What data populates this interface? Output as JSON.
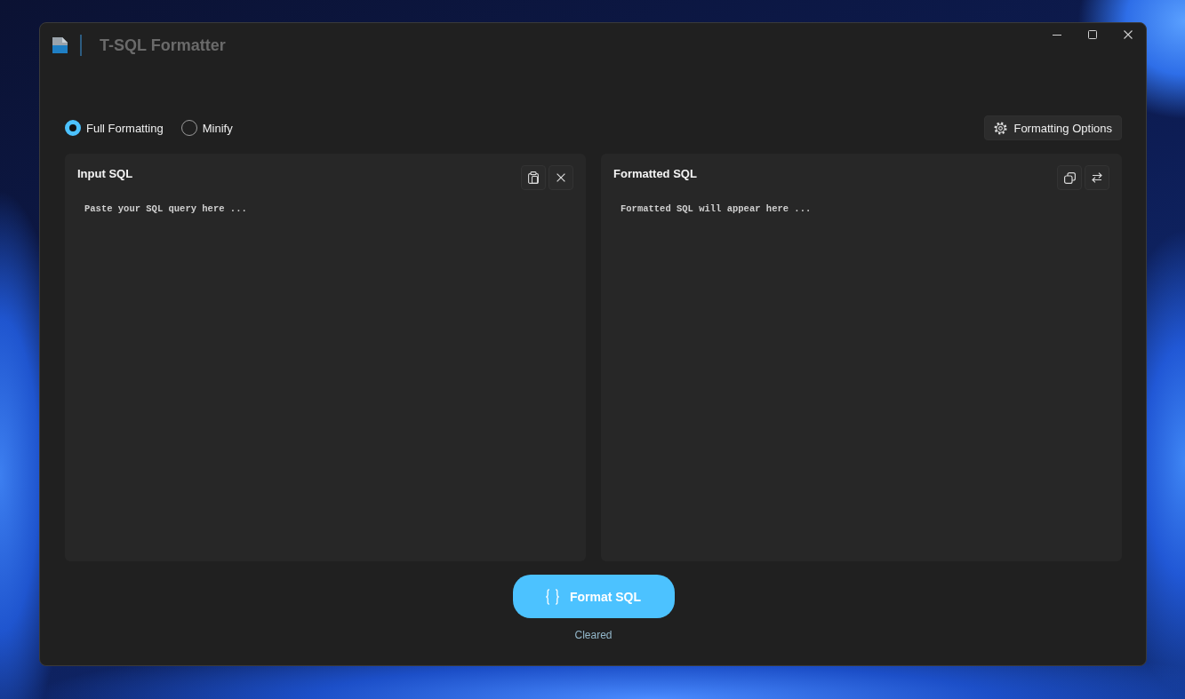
{
  "window": {
    "title": "T-SQL Formatter"
  },
  "mode_options": [
    {
      "label": "Full Formatting",
      "selected": true
    },
    {
      "label": "Minify",
      "selected": false
    }
  ],
  "options_button": {
    "label": "Formatting Options"
  },
  "panels": [
    {
      "title": "Input SQL",
      "placeholder": "Paste your SQL query here ...",
      "actions": [
        {
          "kind": "paste"
        },
        {
          "kind": "clear"
        }
      ]
    },
    {
      "title": "Formatted SQL",
      "placeholder": "Formatted SQL will appear here ...",
      "actions": [
        {
          "kind": "copy"
        },
        {
          "kind": "swap"
        }
      ]
    }
  ],
  "format_button": {
    "label": "Format SQL"
  },
  "status": {
    "text": "Cleared"
  }
}
